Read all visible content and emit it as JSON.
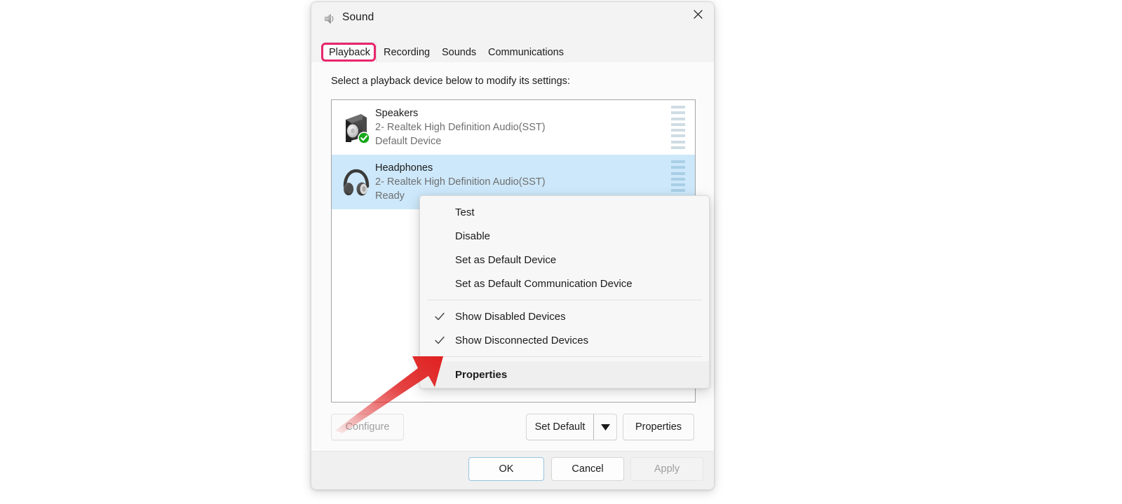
{
  "window": {
    "title": "Sound",
    "icon": "sound-speaker-icon",
    "close_label": "Close"
  },
  "tabs": [
    {
      "label": "Playback",
      "selected": true,
      "annotated": true
    },
    {
      "label": "Recording",
      "selected": false,
      "annotated": false
    },
    {
      "label": "Sounds",
      "selected": false,
      "annotated": false
    },
    {
      "label": "Communications",
      "selected": false,
      "annotated": false
    }
  ],
  "content": {
    "instruction": "Select a playback device below to modify its settings:"
  },
  "devices": [
    {
      "name": "Speakers",
      "driver": "2- Realtek High Definition Audio(SST)",
      "status": "Default Device",
      "icon": "speaker-icon",
      "is_default": true,
      "selected": false,
      "vu_segments": 8
    },
    {
      "name": "Headphones",
      "driver": "2- Realtek High Definition Audio(SST)",
      "status": "Ready",
      "icon": "headphones-icon",
      "is_default": false,
      "selected": true,
      "vu_segments": 8
    }
  ],
  "controls": {
    "configure": "Configure",
    "set_default": "Set Default",
    "set_default_dropdown_icon": "chevron-down-icon",
    "properties": "Properties"
  },
  "footer": {
    "ok": "OK",
    "cancel": "Cancel",
    "apply": "Apply"
  },
  "context_menu": {
    "items": [
      {
        "label": "Test",
        "checked": false,
        "bold": false,
        "highlight": false
      },
      {
        "label": "Disable",
        "checked": false,
        "bold": false,
        "highlight": false
      },
      {
        "label": "Set as Default Device",
        "checked": false,
        "bold": false,
        "highlight": false
      },
      {
        "label": "Set as Default Communication Device",
        "checked": false,
        "bold": false,
        "highlight": false
      },
      {
        "label": "Show Disabled Devices",
        "checked": true,
        "bold": false,
        "highlight": false
      },
      {
        "label": "Show Disconnected Devices",
        "checked": true,
        "bold": false,
        "highlight": false
      },
      {
        "label": "Properties",
        "checked": false,
        "bold": true,
        "highlight": true
      }
    ]
  },
  "annotations": {
    "tab_highlight_color": "#e8266c",
    "arrow_color": "#e02020",
    "arrow_target": "Properties"
  },
  "colors": {
    "selection_blue": "#cde8fa",
    "default_badge_green": "#16a81a",
    "dialog_bg": "#f3f3f3",
    "content_bg": "#fbfbfb"
  }
}
